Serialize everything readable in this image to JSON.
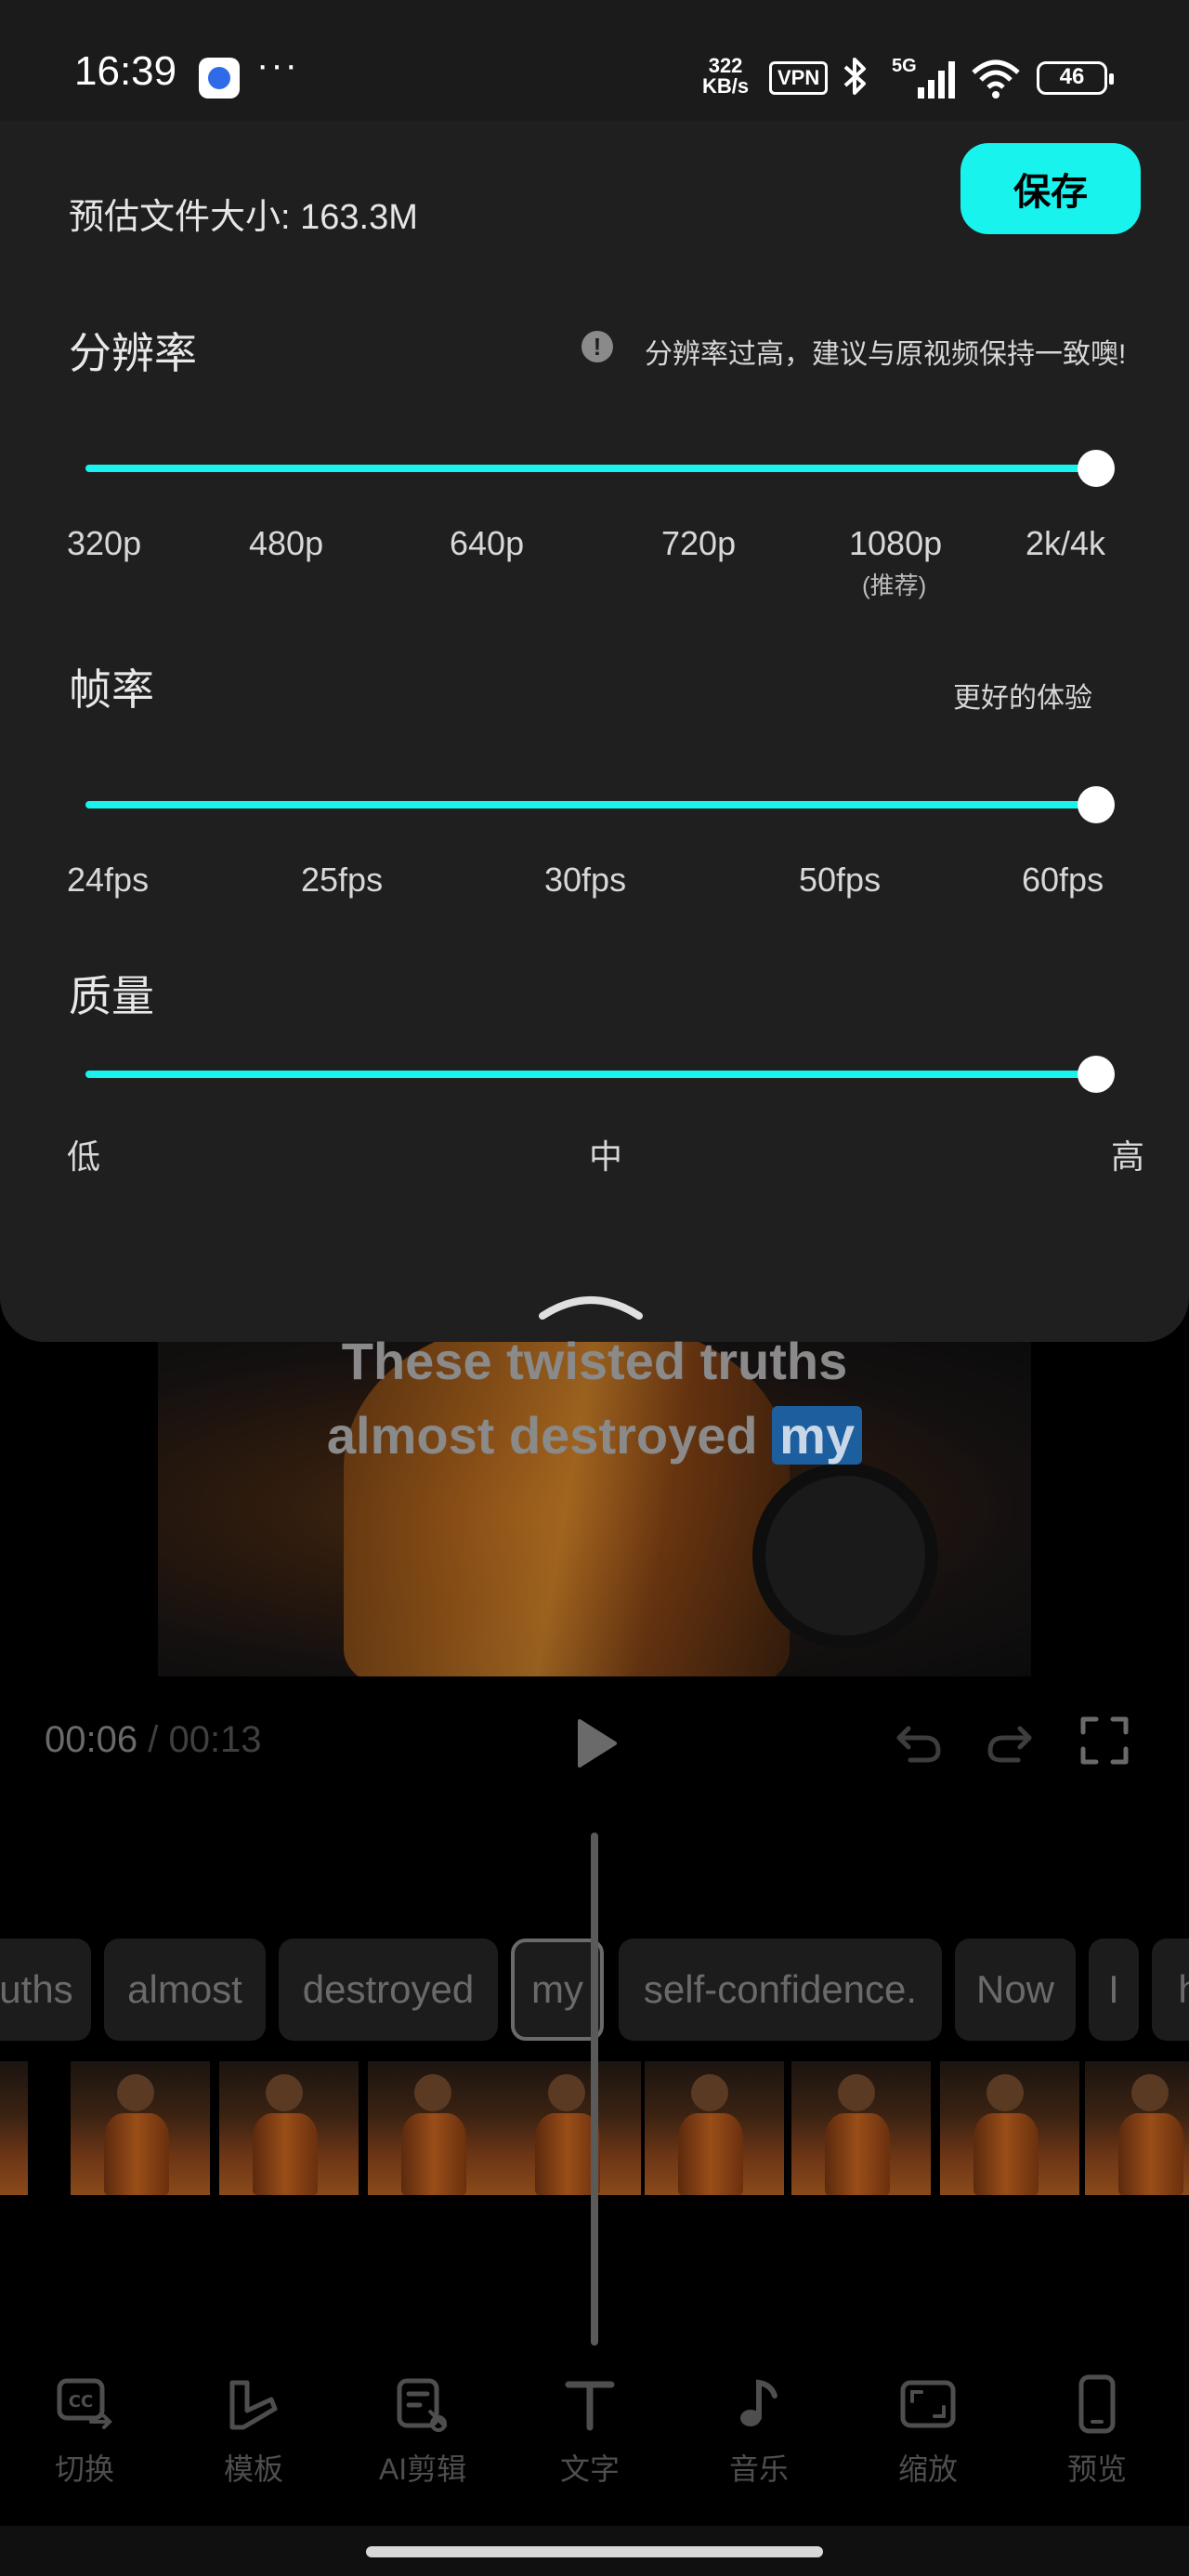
{
  "status_bar": {
    "time": "16:39",
    "more": "···",
    "net_speed_top": "322",
    "net_speed_bottom": "KB/s",
    "vpn": "VPN",
    "network": "5G",
    "battery": "46"
  },
  "export_panel": {
    "file_size": "预估文件大小: 163.3M",
    "save_label": "保存",
    "accent": "#19f3ee",
    "resolution": {
      "title": "分辨率",
      "hint": "分辨率过高，建议与原视频保持一致噢!",
      "ticks": [
        "320p",
        "480p",
        "640p",
        "720p",
        "1080p",
        "2k/4k"
      ],
      "recommended_note": "(推荐)",
      "selected": "2k/4k",
      "level": 1.0
    },
    "frame_rate": {
      "title": "帧率",
      "hint": "更好的体验",
      "ticks": [
        "24fps",
        "25fps",
        "30fps",
        "50fps",
        "60fps"
      ],
      "selected": "60fps",
      "level": 1.0
    },
    "quality": {
      "title": "质量",
      "ticks": [
        "低",
        "中",
        "高"
      ],
      "selected": "高",
      "level": 1.0
    }
  },
  "preview": {
    "caption_line1": "These twisted truths",
    "caption_line2_prefix": "almost destroyed ",
    "caption_line2_highlight": "my"
  },
  "playback": {
    "current_time": "00:06",
    "separator": " / ",
    "total_time": "00:13"
  },
  "timeline": {
    "words": [
      "uths",
      "almost",
      "destroyed",
      "my",
      "self-confidence.",
      "Now",
      "I",
      "h"
    ],
    "selected_word": "my"
  },
  "toolbar": {
    "items": [
      {
        "label": "切换",
        "icon": "caption-switch-icon"
      },
      {
        "label": "模板",
        "icon": "template-icon"
      },
      {
        "label": "AI剪辑",
        "icon": "ai-edit-icon"
      },
      {
        "label": "文字",
        "icon": "text-icon"
      },
      {
        "label": "音乐",
        "icon": "music-icon"
      },
      {
        "label": "缩放",
        "icon": "zoom-icon"
      },
      {
        "label": "预览",
        "icon": "preview-icon"
      }
    ]
  }
}
